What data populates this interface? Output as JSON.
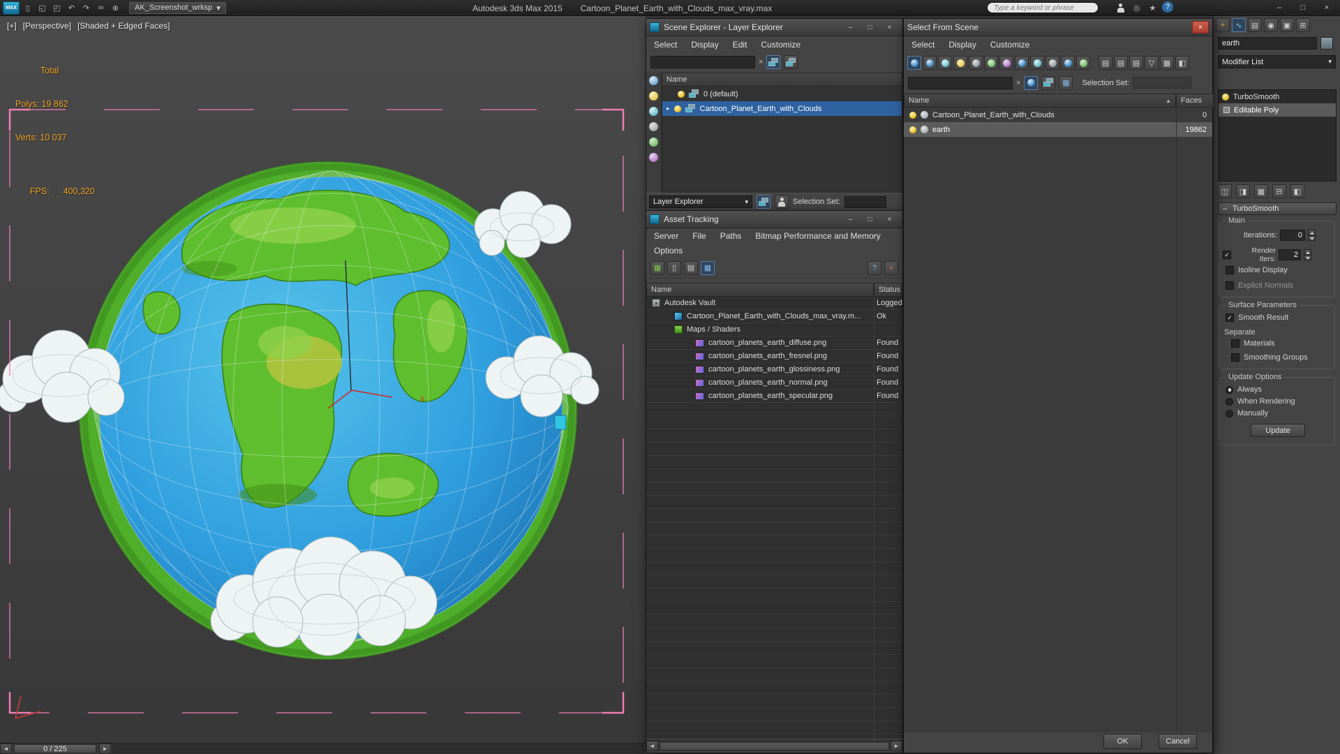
{
  "colors": {
    "selection_blue": "#2f62a0",
    "selection_gray": "#5c5c5c",
    "stats_orange": "#f0a526",
    "bracket_pink": "#ee7eb5",
    "close_red": "#c75a4a",
    "ocean_blue": "#2f9ede",
    "land_green": "#5fbe2d"
  },
  "icons": {
    "close": "×",
    "minimize": "–",
    "maximize": "□",
    "dropdown": "▾",
    "sort_asc": "▲",
    "expand": "▸",
    "check": "✓",
    "clear": "×",
    "help": "?",
    "prev": "◄",
    "next": "►",
    "star": "★",
    "globe": "◎",
    "new_scene": "▯",
    "open_file": "◱",
    "save_file": "◰",
    "undo": "↶",
    "redo": "↷",
    "link": "∞",
    "select_filter": "⊕",
    "tab_create": "+",
    "tab_modify": "∿",
    "tab_hierarchy": "▤",
    "tab_motion": "◉",
    "tab_display": "▣",
    "tab_utilities": "⊞",
    "list": "▤",
    "funnel": "▽",
    "page": "▯",
    "pin": "◫",
    "show_end": "◨",
    "make_unique": "▦",
    "remove_mod": "⊟",
    "config_sets": "◧"
  },
  "titlebar": {
    "workspace": "AK_Screenshot_wrksp",
    "app_name": "Autodesk 3ds Max 2015",
    "file_name": "Cartoon_Planet_Earth_with_Clouds_max_vray.max",
    "search_placeholder": "Type a keyword or phrase"
  },
  "viewport": {
    "label_menu": "[+]",
    "label_pov": "[Perspective]",
    "label_shading": "[Shaded + Edged Faces]",
    "stats": {
      "total": "Total",
      "polys": "Polys: 19 862",
      "verts": "Verts: 10 037",
      "fps_label": "FPS:",
      "fps_value": "400,320"
    },
    "axis_label": "x",
    "frame_indicator": "0 / 225"
  },
  "scene_explorer": {
    "title": "Scene Explorer - Layer Explorer",
    "menus": [
      "Select",
      "Display",
      "Edit",
      "Customize"
    ],
    "header_name": "Name",
    "rows": [
      {
        "label": "0 (default)"
      },
      {
        "label": "Cartoon_Planet_Earth_with_Clouds"
      }
    ],
    "footer_mode": "Layer Explorer",
    "selection_set_label": "Selection Set:"
  },
  "asset_tracking": {
    "title": "Asset Tracking",
    "menus_line1": [
      "Server",
      "File",
      "Paths",
      "Bitmap Performance and Memory"
    ],
    "menus_line2": [
      "Options"
    ],
    "col_name": "Name",
    "col_status": "Status",
    "rows": [
      {
        "name": "Autodesk Vault",
        "status": "Logged"
      },
      {
        "name": "Cartoon_Planet_Earth_with_Clouds_max_vray.m...",
        "status": "Ok"
      },
      {
        "name": "Maps / Shaders",
        "status": ""
      },
      {
        "name": "cartoon_planets_earth_diffuse.png",
        "status": "Found"
      },
      {
        "name": "cartoon_planets_earth_fresnel.png",
        "status": "Found"
      },
      {
        "name": "cartoon_planets_earth_glossiness.png",
        "status": "Found"
      },
      {
        "name": "cartoon_planets_earth_normal.png",
        "status": "Found"
      },
      {
        "name": "cartoon_planets_earth_specular.png",
        "status": "Found"
      }
    ]
  },
  "select_from_scene": {
    "title": "Select From Scene",
    "menus": [
      "Select",
      "Display",
      "Customize"
    ],
    "selection_set_label": "Selection Set:",
    "col_name": "Name",
    "col_faces": "Faces",
    "rows": [
      {
        "name": "Cartoon_Planet_Earth_with_Clouds",
        "faces": "0"
      },
      {
        "name": "earth",
        "faces": "19862"
      }
    ],
    "ok": "OK",
    "cancel": "Cancel"
  },
  "command_panel": {
    "object_name": "earth",
    "modifier_list": "Modifier List",
    "stack": [
      {
        "label": "TurboSmooth"
      },
      {
        "label": "Editable Poly"
      }
    ],
    "rollout_title": "TurboSmooth",
    "groups": {
      "main": "Main",
      "surface": "Surface Parameters",
      "update": "Update Options"
    },
    "iterations_label": "Iterations:",
    "iterations_value": "0",
    "render_iters_label": "Render Iters:",
    "render_iters_value": "2",
    "isoline_label": "Isoline Display",
    "explicit_normals_label": "Explicit Normals",
    "smooth_result_label": "Smooth Result",
    "separate_label": "Separate",
    "materials_label": "Materials",
    "smoothing_groups_label": "Smoothing Groups",
    "always_label": "Always",
    "when_rendering_label": "When Rendering",
    "manually_label": "Manually",
    "update_button": "Update"
  }
}
